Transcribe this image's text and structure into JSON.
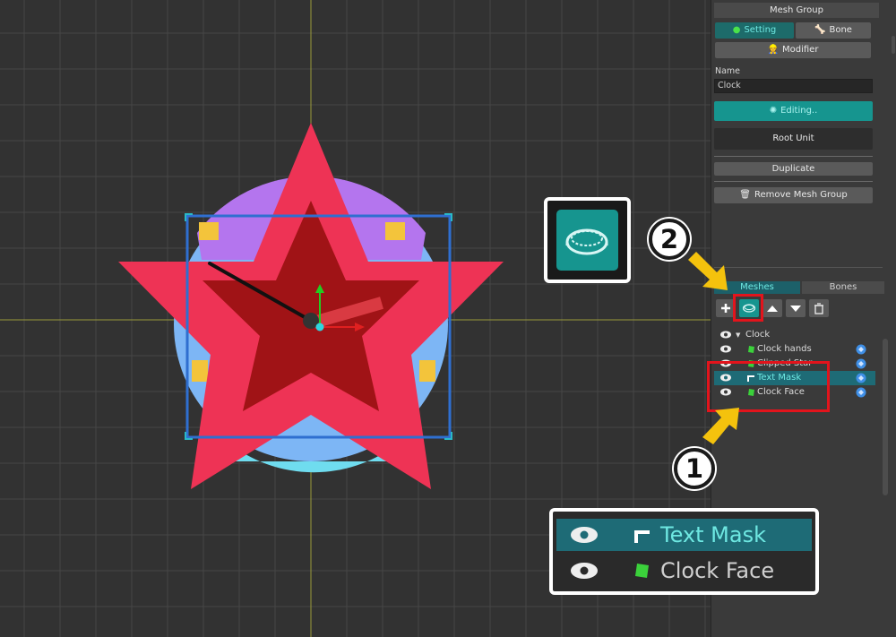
{
  "colors": {
    "accent": "#1e6b76",
    "accent_text": "#6ee8e2",
    "highlight": "#e2141c",
    "arrow": "#f4c20d",
    "star_outer": "#ee3355",
    "star_inner": "#a01316"
  },
  "panel": {
    "header": "Mesh Group",
    "tabs": {
      "setting": "Setting",
      "bone": "Bone"
    },
    "modifier": "Modifier",
    "name_label": "Name",
    "name_value": "Clock",
    "editing": "Editing..",
    "root_unit": "Root Unit",
    "duplicate": "Duplicate",
    "remove": "Remove Mesh Group"
  },
  "layers": {
    "tabs": {
      "meshes": "Meshes",
      "bones": "Bones"
    },
    "toolbar": [
      "add-icon",
      "mask-mesh-icon",
      "move-up-icon",
      "move-down-icon",
      "trash-icon"
    ],
    "root": "Clock",
    "items": [
      {
        "label": "Clock hands",
        "icon": "mesh-icon"
      },
      {
        "label": "Clipped Star",
        "icon": "mesh-icon"
      },
      {
        "label": "Text Mask",
        "icon": "clip-icon",
        "selected": true
      },
      {
        "label": "Clock Face",
        "icon": "mesh-icon"
      }
    ]
  },
  "callouts": {
    "one": "1",
    "two": "2"
  },
  "zoom": {
    "text_mask": "Text Mask",
    "clock_face": "Clock Face"
  }
}
